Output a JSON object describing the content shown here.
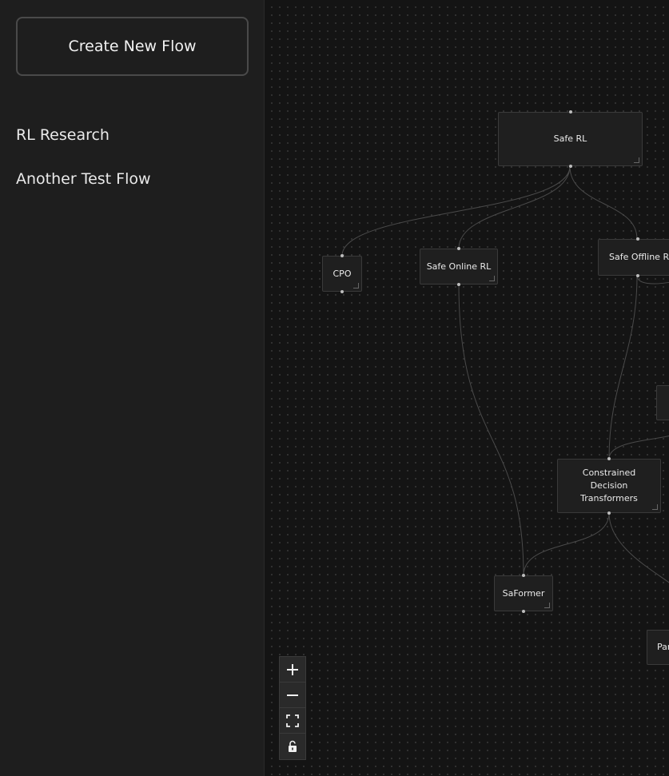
{
  "sidebar": {
    "create_button_label": "Create New Flow",
    "flows": [
      {
        "label": "RL Research"
      },
      {
        "label": "Another Test Flow"
      }
    ]
  },
  "canvas": {
    "nodes": {
      "safe_rl": "Safe RL",
      "cpo": "CPO",
      "safe_online_rl": "Safe Online RL",
      "safe_offline_rl": "Safe Offline RL",
      "cdt": "Constrained Decision Transformers",
      "saformer": "SaFormer",
      "partial_right": "Par"
    }
  },
  "controls": {
    "icons": [
      "zoom-in-icon",
      "zoom-out-icon",
      "fit-view-icon",
      "lock-icon"
    ]
  }
}
